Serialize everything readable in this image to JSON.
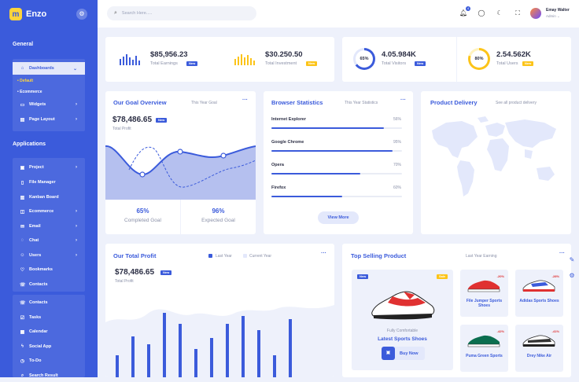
{
  "brand": {
    "name": "Enzo",
    "mark": "m"
  },
  "sidebar": {
    "general_heading": "General",
    "dashboards": "Dashboards",
    "sub_default": "Default",
    "sub_ecommerce": "Ecommerce",
    "widgets": "Widgets",
    "page_layout": "Page Layout",
    "applications_heading": "Applications",
    "apps": [
      "Project",
      "File Manager",
      "Kanban Board",
      "Ecommerce",
      "Email",
      "Chat",
      "Users",
      "Bookmarks",
      "Contacts"
    ],
    "contacts2": "Contacts",
    "tasks": "Tasks",
    "calendar": "Calendar",
    "social": "Social App",
    "todo": "To-Do",
    "search_result": "Search Result"
  },
  "topbar": {
    "search_placeholder": "Search Here.....",
    "notif_count": "4",
    "user_name": "Emay Walter",
    "user_role": "Admin ⌄"
  },
  "stats": [
    {
      "value": "$85,956.23",
      "label": "Total Earnings",
      "badge": "New",
      "badge_color": "#3b5bdb"
    },
    {
      "value": "$30.250.50",
      "label": "Total Investment",
      "badge": "New",
      "badge_color": "#fcc419"
    },
    {
      "value": "4.05.984K",
      "label": "Total Visitors",
      "badge": "New",
      "badge_color": "#3b5bdb",
      "ring": "65%",
      "ring_pct": 65
    },
    {
      "value": "2.54.562K",
      "label": "Total Users",
      "badge": "New",
      "badge_color": "#fcc419",
      "ring": "80%",
      "ring_pct": 80
    }
  ],
  "goal": {
    "title": "Our Goal Overview",
    "period": "This Year Goal",
    "value": "$78,486.65",
    "badge": "New",
    "label": "Total Profit",
    "completed_pct": "65%",
    "completed_lbl": "Completed Goal",
    "expected_pct": "96%",
    "expected_lbl": "Expected Goal"
  },
  "browser": {
    "title": "Browser Statistics",
    "period": "This Year Statistics",
    "button": "View More",
    "items": [
      {
        "name": "Internet Explorer",
        "pct": "56%",
        "fill": 0.86
      },
      {
        "name": "Google Chrome",
        "pct": "95%",
        "fill": 0.93
      },
      {
        "name": "Opera",
        "pct": "70%",
        "fill": 0.68
      },
      {
        "name": "Firefox",
        "pct": "60%",
        "fill": 0.54
      }
    ]
  },
  "delivery": {
    "title": "Product Delivery",
    "link": "See all product delivery"
  },
  "profit": {
    "title": "Our Total Profit",
    "legend_last": "Last Year",
    "legend_current": "Current Year",
    "value": "$78,486.65",
    "badge": "New",
    "label": "Total Profit"
  },
  "top_selling": {
    "title": "Top Selling Product",
    "period": "Last Year Earning",
    "featured": {
      "badge_new": "New",
      "badge_sale": "Sale",
      "tagline": "Fully Comfortable",
      "name": "Latest Sports Shoes",
      "button": "Buy Now"
    },
    "products": [
      {
        "name": "File Jumper Sports Shoes",
        "discount": "-20%"
      },
      {
        "name": "Adidas Sports Shoes",
        "discount": "-28%"
      },
      {
        "name": "Puma Green Sports",
        "discount": "-42%"
      },
      {
        "name": "Drey Nike Air",
        "discount": "-41%"
      }
    ]
  },
  "colors": {
    "primary": "#3b5bdb",
    "accent": "#fcc419",
    "background": "#eef1fb"
  }
}
